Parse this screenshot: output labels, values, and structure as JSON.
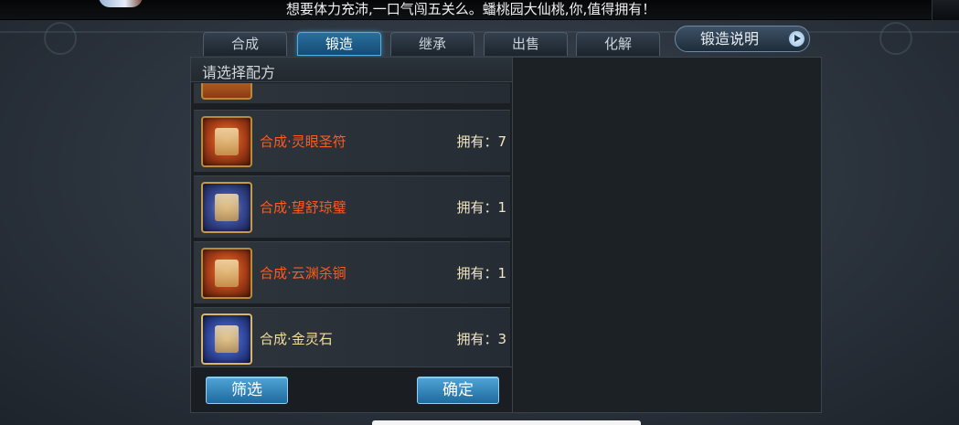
{
  "marquee": {
    "text": "想要体力充沛,一口气闯五关么。蟠桃园大仙桃,你,值得拥有！"
  },
  "tabs": [
    {
      "label": "合成",
      "active": false
    },
    {
      "label": "锻造",
      "active": true
    },
    {
      "label": "继承",
      "active": false
    },
    {
      "label": "出售",
      "active": false
    },
    {
      "label": "化解",
      "active": false
    }
  ],
  "help_button": {
    "label": "锻造说明",
    "icon": "play-arrow-icon"
  },
  "recipe_panel": {
    "title": "请选择配方",
    "items": [
      {
        "name": "合成·灵眼圣符",
        "count": "拥有：7",
        "name_color": "#ff5a1f",
        "icon": "talisman-scroll-icon"
      },
      {
        "name": "合成·望舒琼璧",
        "count": "拥有：1",
        "name_color": "#ff5a1f",
        "icon": "jade-scroll-icon"
      },
      {
        "name": "合成·云渊杀锏",
        "count": "拥有：1",
        "name_color": "#ff5a1f",
        "icon": "mace-scroll-icon"
      },
      {
        "name": "合成·金灵石",
        "count": "拥有：3",
        "name_color": "#f3dd9a",
        "icon": "gold-stone-scroll-icon"
      }
    ]
  },
  "footer": {
    "filter_label": "筛选",
    "confirm_label": "确定"
  },
  "colors": {
    "accent_blue": "#2a6f9e",
    "rare_orange": "#ff5a1f",
    "common_gold": "#f3dd9a"
  }
}
